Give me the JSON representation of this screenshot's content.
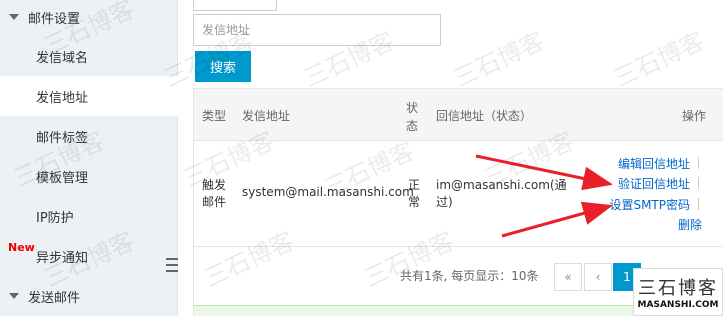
{
  "sidebar": {
    "group_mail_settings": "邮件设置",
    "items": [
      {
        "label": "发信域名"
      },
      {
        "label": "发信地址"
      },
      {
        "label": "邮件标签"
      },
      {
        "label": "模板管理"
      },
      {
        "label": "IP防护"
      },
      {
        "label": "异步通知"
      }
    ],
    "new_badge": "New",
    "group_send_mail": "发送邮件"
  },
  "search": {
    "placeholder": "发信地址",
    "button_label": "搜索"
  },
  "table": {
    "headers": {
      "type": "类型",
      "sender": "发信地址",
      "status": "状态",
      "reply": "回信地址（状态）",
      "actions": "操作"
    },
    "rows": [
      {
        "type": "触发邮件",
        "sender": "system@mail.masanshi.com",
        "status": "正常",
        "reply": "im@masanshi.com(通过)",
        "actions": [
          "编辑回信地址",
          "验证回信地址",
          "设置SMTP密码",
          "删除"
        ]
      }
    ]
  },
  "pagination": {
    "summary": "共有1条, 每页显示：10条",
    "first": "«",
    "prev": "‹",
    "current": "1"
  },
  "watermark": {
    "text": "三石博客",
    "logo_line1": "三石博客",
    "logo_line2": "MASANSHI.COM"
  },
  "colors": {
    "accent": "#0099cc",
    "link": "#0066cc",
    "arrow": "#e8202a",
    "new_badge": "#ee0000"
  }
}
